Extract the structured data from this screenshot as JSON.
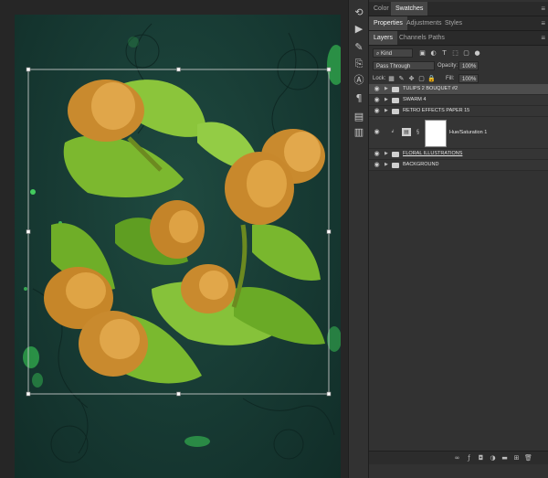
{
  "top_tabs": [
    {
      "label": "Color",
      "active": false
    },
    {
      "label": "Swatches",
      "active": true
    }
  ],
  "mid_tabs": [
    {
      "label": "Properties",
      "active": true
    },
    {
      "label": "Adjustments",
      "active": false
    },
    {
      "label": "Styles",
      "active": false
    }
  ],
  "layer_tabs": [
    {
      "label": "Layers",
      "active": true
    },
    {
      "label": "Channels",
      "active": false
    },
    {
      "label": "Paths",
      "active": false
    }
  ],
  "filter": {
    "label": "Kind"
  },
  "blend": {
    "mode": "Pass Through",
    "opacity_label": "Opacity:",
    "opacity_value": "100%"
  },
  "lock": {
    "label": "Lock:",
    "fill_label": "Fill:",
    "fill_value": "100%"
  },
  "layers": [
    {
      "name": "TULIPS 2 BOUQUET #2",
      "type": "group",
      "selected": true
    },
    {
      "name": "SWARM 4",
      "type": "group",
      "selected": false
    },
    {
      "name": "RETRO EFFECTS PAPER 15",
      "type": "group",
      "selected": false
    },
    {
      "name": "Hue/Saturation 1",
      "type": "adjustment",
      "selected": false
    },
    {
      "name": "FLORAL ILLUSTRATIONS",
      "type": "group",
      "selected": false
    },
    {
      "name": "BACKGROUND",
      "type": "group",
      "selected": false
    }
  ],
  "colors": {
    "accent_green": "#33c458",
    "tulip_orange": "#c98a2e",
    "panel_bg": "#323232"
  }
}
